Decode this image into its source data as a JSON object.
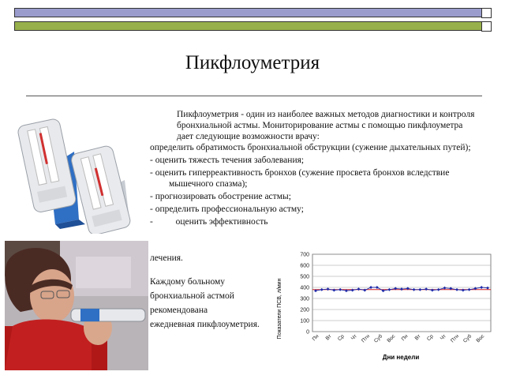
{
  "header": {
    "title": "Пикфлоуметрия"
  },
  "body": {
    "intro": "Пикфлоуметрия - один из наиболее важных методов диагностики и контроля бронхиальной астмы. Мониторирование астмы с помощью пикфлоуметра дает следующие возможности врачу:",
    "items": [
      "определить обратимость бронхиальной обструкции (сужение дыхательных путей);",
      "- оценить тяжесть течения заболевания;",
      "- оценить гиперреактивность бронхов (сужение просвета бронхов вследствие мышечного спазма);",
      "- прогнозировать обострение астмы;",
      "- определить профессиональную астму;",
      "-          оценить эффективность"
    ],
    "treatment": "лечения.",
    "closing": [
      "Каждому больному",
      "бронхиальной астмой",
      "рекомендована",
      "ежедневная пикфлоуметрия."
    ]
  },
  "colors": {
    "bar_top": "#9a9ccc",
    "bar_bottom": "#98b04c",
    "series": "#1f2aa8",
    "reference_line": "#d42020"
  },
  "chart_data": {
    "type": "line",
    "xlabel": "Дни недели",
    "ylabel": "Показатели ПСВ, л/мин",
    "ylim": [
      0,
      700
    ],
    "yticks": [
      0,
      100,
      200,
      300,
      400,
      500,
      600,
      700
    ],
    "categories": [
      "Пн",
      "Вт",
      "Ср",
      "Чт",
      "Птн",
      "Суб",
      "Вос",
      "Пн",
      "Вт",
      "Ср",
      "Чт",
      "Птн",
      "Суб",
      "Вос"
    ],
    "grid": true,
    "series": [
      {
        "values": [
          370,
          380,
          385,
          375,
          380,
          370,
          375,
          385,
          375,
          400,
          400,
          370,
          380,
          390,
          385,
          390,
          380,
          380,
          385,
          375,
          380,
          395,
          390,
          380,
          375,
          380,
          390,
          400,
          395
        ]
      }
    ],
    "reference_value": 380
  }
}
